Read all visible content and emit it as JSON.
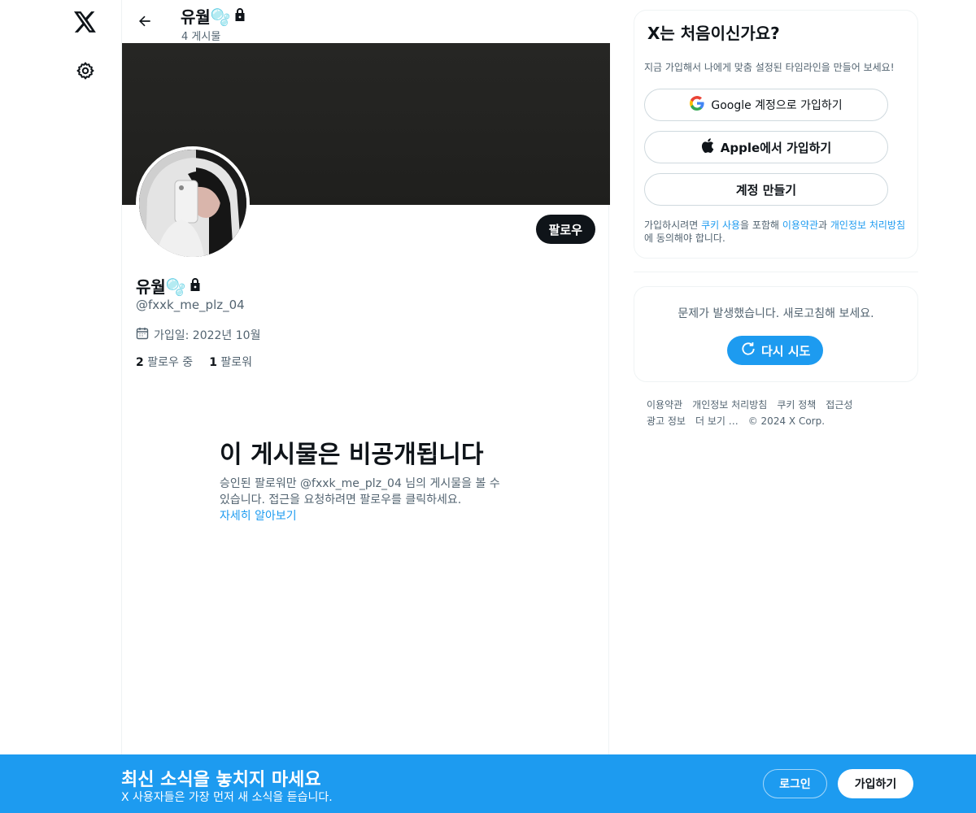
{
  "nav": {
    "logo_icon": "x-logo-icon",
    "settings_icon": "gear-icon"
  },
  "header": {
    "name": "유월🫧",
    "posts_count": "4 게시물"
  },
  "profile": {
    "name": "유월🫧",
    "handle": "@fxxk_me_plz_04",
    "joined": "가입일: 2022년 10월",
    "following_count": "2",
    "following_label": "팔로우 중",
    "followers_count": "1",
    "followers_label": "팔로워",
    "follow_label": "팔로우"
  },
  "private_notice": {
    "title": "이 게시물은 비공개됩니다",
    "body": "승인된 팔로워만 @fxxk_me_plz_04 님의 게시물을 볼 수 있습니다. 접근을 요청하려면 팔로우를 클릭하세요.",
    "link": "자세히 알아보기"
  },
  "signup_card": {
    "title": "X는 처음이신가요?",
    "subtitle": "지금 가입해서 나에게 맞춤 설정된 타임라인을 만들어 보세요!",
    "google_label": "Google 계정으로 가입하기",
    "apple_label": "Apple에서 가입하기",
    "create_label": "계정 만들기",
    "terms_prefix": "가입하시려면 ",
    "terms_cookie": "쿠키 사용",
    "terms_mid1": "을 포함해 ",
    "terms_tos": "이용약관",
    "terms_mid2": "과 ",
    "terms_privacy": "개인정보 처리방침",
    "terms_suffix": "에 동의해야 합니다."
  },
  "error_card": {
    "message": "문제가 발생했습니다. 새로고침해 보세요.",
    "retry_label": "다시 시도"
  },
  "footer": {
    "links": [
      "이용약관",
      "개인정보 처리방침",
      "쿠키 정책",
      "접근성",
      "광고 정보",
      "더 보기 …"
    ],
    "copyright": "© 2024 X Corp."
  },
  "bottom_bar": {
    "title": "최신 소식을 놓치지 마세요",
    "subtitle": "X 사용자들은 가장 먼저 새 소식을 듣습니다.",
    "login_label": "로그인",
    "signup_label": "가입하기"
  },
  "colors": {
    "accent": "#1d9bf0",
    "text": "#0f1419",
    "muted": "#536471"
  }
}
